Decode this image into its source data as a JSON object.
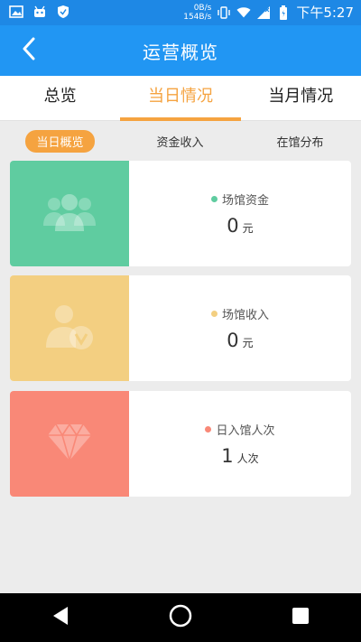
{
  "status": {
    "net_up": "0B/s",
    "net_down": "154B/s",
    "time": "下午5:27"
  },
  "app": {
    "title": "运营概览",
    "back_icon": "back-arrow-icon"
  },
  "tabs": [
    {
      "label": "总览",
      "active": false
    },
    {
      "label": "当日情况",
      "active": true
    },
    {
      "label": "当月情况",
      "active": false
    }
  ],
  "subtabs": [
    {
      "label": "当日概览",
      "active": true
    },
    {
      "label": "资金收入",
      "active": false
    },
    {
      "label": "在馆分布",
      "active": false
    }
  ],
  "cards": [
    {
      "label": "场馆资金",
      "value": "0",
      "unit": "元",
      "color": "#5fcca0",
      "dot": "#5fcca0",
      "icon": "users-group-icon"
    },
    {
      "label": "场馆收入",
      "value": "0",
      "unit": "元",
      "color": "#f3cf81",
      "dot": "#f3cf81",
      "icon": "user-badge-icon"
    },
    {
      "label": "日入馆人次",
      "value": "1",
      "unit": "人次",
      "color": "#f98877",
      "dot": "#f98877",
      "icon": "diamond-icon"
    }
  ],
  "colors": {
    "primary": "#2196f3",
    "accent": "#f5a340"
  }
}
